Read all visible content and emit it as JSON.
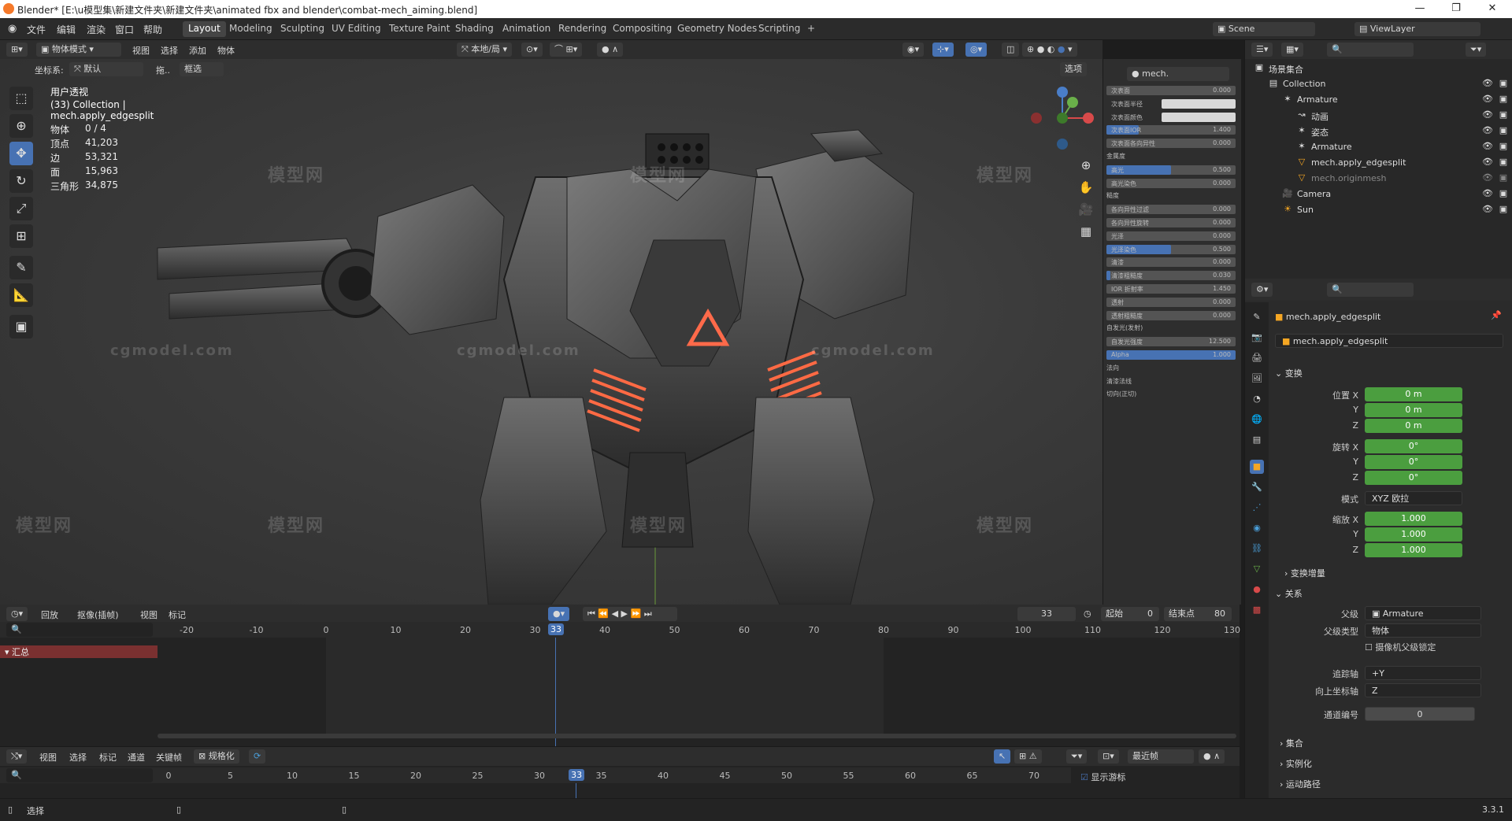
{
  "window": {
    "title": "Blender* [E:\\u模型集\\新建文件夹\\新建文件夹\\animated fbx and blender\\combat-mech_aiming.blend]",
    "buttons": [
      "—",
      "❐",
      "✕"
    ]
  },
  "menubar": {
    "items": [
      "文件",
      "编辑",
      "渲染",
      "窗口",
      "帮助"
    ],
    "workspaces": [
      "Layout",
      "Modeling",
      "Sculpting",
      "UV Editing",
      "Texture Paint",
      "Shading",
      "Animation",
      "Rendering",
      "Compositing",
      "Geometry Nodes",
      "Scripting",
      "+"
    ],
    "active_workspace": "Layout",
    "scene_label": "Scene",
    "viewlayer_label": "ViewLayer"
  },
  "viewport_header": {
    "mode": "物体模式",
    "menus": [
      "视图",
      "选择",
      "添加",
      "物体"
    ],
    "transform_orientation": "本地/局",
    "coord_label": "坐标系:",
    "coord_value": "默认",
    "drag_label": "拖..",
    "drag_value": "框选",
    "options_label": "选项"
  },
  "viewport": {
    "view_name": "用户透视",
    "collection_line": "(33) Collection | mech.apply_edgesplit",
    "stats": [
      {
        "label": "物体",
        "value": "0 / 4"
      },
      {
        "label": "顶点",
        "value": "41,203"
      },
      {
        "label": "边",
        "value": "53,321"
      },
      {
        "label": "面",
        "value": "15,963"
      },
      {
        "label": "三角形",
        "value": "34,875"
      }
    ],
    "watermarks": [
      "模型网",
      "cgmodel.com"
    ],
    "tools": [
      "select-box-icon",
      "cursor-icon",
      "move-icon",
      "rotate-icon",
      "scale-icon",
      "transform-icon",
      "annotate-icon",
      "measure-icon",
      "add-cube-icon"
    ]
  },
  "material_panel": {
    "header": "mech.",
    "rows": [
      {
        "label": "次表面",
        "value": "0.000",
        "fill": 0
      },
      {
        "label": "次表面半径",
        "value": "",
        "fill": 0,
        "white": true
      },
      {
        "label": "次表面颜色",
        "value": "",
        "fill": 0,
        "white": true
      },
      {
        "label": "次表面IOR",
        "value": "1.400",
        "fill": 0.25
      },
      {
        "label": "次表面各向异性",
        "value": "0.000",
        "fill": 0
      },
      {
        "label": "金属度",
        "value": "",
        "section": true
      },
      {
        "label": "高光",
        "value": "0.500",
        "fill": 0.5
      },
      {
        "label": "高光染色",
        "value": "0.000",
        "fill": 0
      },
      {
        "label": "糙度",
        "value": "",
        "section": true
      },
      {
        "label": "各向异性过滤",
        "value": "0.000",
        "fill": 0
      },
      {
        "label": "各向异性旋转",
        "value": "0.000",
        "fill": 0
      },
      {
        "label": "光泽",
        "value": "0.000",
        "fill": 0
      },
      {
        "label": "光泽染色",
        "value": "0.500",
        "fill": 0.5
      },
      {
        "label": "清漆",
        "value": "0.000",
        "fill": 0
      },
      {
        "label": "清漆粗糙度",
        "value": "0.030",
        "fill": 0.03
      },
      {
        "label": "IOR 折射率",
        "value": "1.450",
        "fill": 0
      },
      {
        "label": "透射",
        "value": "0.000",
        "fill": 0
      },
      {
        "label": "透射粗糙度",
        "value": "0.000",
        "fill": 0
      },
      {
        "label": "自发光(发射)",
        "value": "",
        "section": true
      },
      {
        "label": "自发光强度",
        "value": "12.500",
        "fill": 0
      },
      {
        "label": "Alpha",
        "value": "1.000",
        "fill": 1
      },
      {
        "label": "法向",
        "value": "",
        "section": true
      },
      {
        "label": "清漆法线",
        "value": "",
        "section": true
      },
      {
        "label": "切向(正切)",
        "value": "",
        "section": true
      }
    ]
  },
  "outliner": {
    "root": "场景集合",
    "items": [
      {
        "name": "Collection",
        "indent": 1,
        "icon": "collection-icon"
      },
      {
        "name": "Armature",
        "indent": 2,
        "icon": "armature-icon"
      },
      {
        "name": "动画",
        "indent": 3,
        "icon": "animation-icon"
      },
      {
        "name": "姿态",
        "indent": 3,
        "icon": "pose-icon"
      },
      {
        "name": "Armature",
        "indent": 3,
        "icon": "armature-data-icon"
      },
      {
        "name": "mech.apply_edgesplit",
        "indent": 3,
        "icon": "mesh-icon"
      },
      {
        "name": "mech.originmesh",
        "indent": 3,
        "icon": "mesh-icon",
        "dim": true
      },
      {
        "name": "Camera",
        "indent": 2,
        "icon": "camera-icon"
      },
      {
        "name": "Sun",
        "indent": 2,
        "icon": "light-icon"
      }
    ]
  },
  "properties": {
    "object_name": "mech.apply_edgesplit",
    "object_field": "mech.apply_edgesplit",
    "transform_section": "变换",
    "location": [
      {
        "label": "位置 X",
        "value": "0 m"
      },
      {
        "label": "Y",
        "value": "0 m"
      },
      {
        "label": "Z",
        "value": "0 m"
      }
    ],
    "rotation": [
      {
        "label": "旋转 X",
        "value": "0°"
      },
      {
        "label": "Y",
        "value": "0°"
      },
      {
        "label": "Z",
        "value": "0°"
      }
    ],
    "mode_label": "模式",
    "mode_value": "XYZ 欧拉",
    "scale": [
      {
        "label": "缩放 X",
        "value": "1.000"
      },
      {
        "label": "Y",
        "value": "1.000"
      },
      {
        "label": "Z",
        "value": "1.000"
      }
    ],
    "delta_section": "变换增量",
    "relations_section": "关系",
    "parent_label": "父级",
    "parent_value": "Armature",
    "parent_type_label": "父级类型",
    "parent_type_value": "物体",
    "camera_lock_label": "摄像机父级锁定",
    "track_axis_label": "追踪轴",
    "track_axis_value": "+Y",
    "up_axis_label": "向上坐标轴",
    "up_axis_value": "Z",
    "pass_index_label": "通道编号",
    "pass_index_value": "0",
    "collections_section": "集合",
    "instancing_section": "实例化",
    "motion_paths_section": "运动路径",
    "version": "3.3.1"
  },
  "timeline": {
    "menus": [
      "回放",
      "抠像(插帧)",
      "视图",
      "标记"
    ],
    "current_frame": "33",
    "start_label": "起始",
    "start_value": "0",
    "end_label": "结束点",
    "end_value": "80",
    "summary_label": "汇总",
    "ruler_ticks": [
      "-20",
      "-10",
      "0",
      "10",
      "20",
      "30",
      "40",
      "50",
      "60",
      "70",
      "80",
      "90",
      "100",
      "110",
      "120",
      "130"
    ]
  },
  "dopesheet": {
    "menus": [
      "视图",
      "选择",
      "标记",
      "通道",
      "关键帧"
    ],
    "normalize_label": "规格化",
    "snap_label": "最近帧",
    "show_cursor_label": "显示游标",
    "ruler_ticks": [
      "0",
      "5",
      "10",
      "15",
      "20",
      "25",
      "30",
      "35",
      "40",
      "45",
      "50",
      "55",
      "60",
      "65",
      "70"
    ],
    "current_frame": "33"
  },
  "statusbar": {
    "select_label": "选择",
    "version": "3.3.1"
  },
  "colors": {
    "accent": "#4772b3",
    "field_green": "#4b9e3f",
    "summary_red": "#7a3030"
  }
}
